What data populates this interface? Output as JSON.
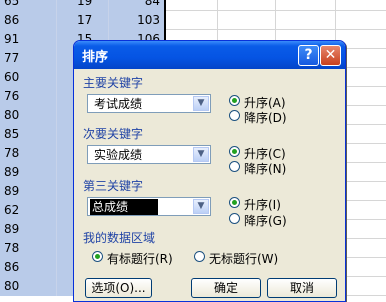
{
  "sheet": {
    "rows": [
      {
        "a": "65",
        "b": "19",
        "c": "84"
      },
      {
        "a": "86",
        "b": "17",
        "c": "103"
      },
      {
        "a": "91",
        "b": "15",
        "c": "106"
      },
      {
        "a": "77",
        "b": "",
        "c": ""
      },
      {
        "a": "60",
        "b": "",
        "c": ""
      },
      {
        "a": "76",
        "b": "",
        "c": ""
      },
      {
        "a": "80",
        "b": "",
        "c": ""
      },
      {
        "a": "85",
        "b": "",
        "c": ""
      },
      {
        "a": "78",
        "b": "",
        "c": ""
      },
      {
        "a": "89",
        "b": "",
        "c": ""
      },
      {
        "a": "89",
        "b": "",
        "c": ""
      },
      {
        "a": "62",
        "b": "",
        "c": ""
      },
      {
        "a": "89",
        "b": "",
        "c": ""
      },
      {
        "a": "78",
        "b": "",
        "c": ""
      },
      {
        "a": "86",
        "b": "",
        "c": ""
      },
      {
        "a": "80",
        "b": "",
        "c": ""
      }
    ]
  },
  "dialog": {
    "title": "排序",
    "help_icon": "question-icon",
    "close_icon": "close-icon",
    "key1": {
      "label": "主要关键字",
      "value": "考试成绩",
      "asc": "升序(A)",
      "desc": "降序(D)",
      "selected": "asc"
    },
    "key2": {
      "label": "次要关键字",
      "value": "实验成绩",
      "asc": "升序(C)",
      "desc": "降序(N)",
      "selected": "asc"
    },
    "key3": {
      "label": "第三关键字",
      "value": "总成绩",
      "asc": "升序(I)",
      "desc": "降序(G)",
      "selected": "asc"
    },
    "range": {
      "label": "我的数据区域",
      "has_header": "有标题行(R)",
      "no_header": "无标题行(W)",
      "selected": "has_header"
    },
    "buttons": {
      "options": "选项(O)...",
      "ok": "确定",
      "cancel": "取消"
    }
  }
}
